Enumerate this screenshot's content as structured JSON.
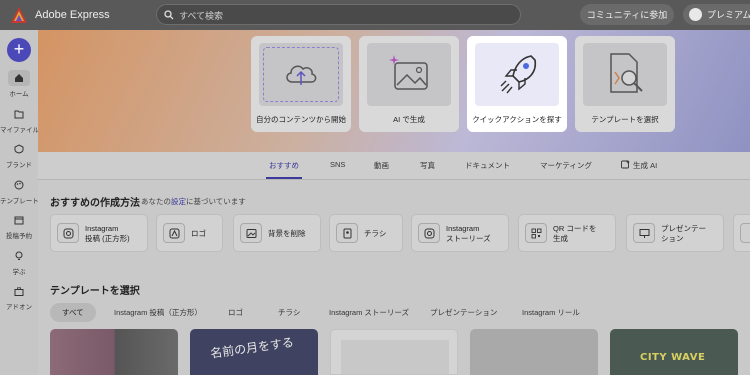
{
  "app": {
    "title": "Adobe Express"
  },
  "search": {
    "placeholder": "すべて検索"
  },
  "header": {
    "community_label": "コミュニティに参加",
    "premium_label": "プレミアム"
  },
  "sidebar": {
    "items": [
      {
        "label": "ホーム",
        "icon": "home-icon"
      },
      {
        "label": "マイファイル",
        "icon": "folder-icon"
      },
      {
        "label": "ブランド",
        "icon": "brand-icon"
      },
      {
        "label": "テンプレート",
        "icon": "palette-icon"
      },
      {
        "label": "投稿予約",
        "icon": "calendar-icon"
      },
      {
        "label": "学ぶ",
        "icon": "lightbulb-icon"
      },
      {
        "label": "アドオン",
        "icon": "briefcase-icon"
      }
    ]
  },
  "hero": {
    "cards": [
      {
        "label": "自分のコンテンツから開始",
        "icon": "cloud-upload-icon"
      },
      {
        "label": "AI で生成",
        "icon": "ai-image-icon"
      },
      {
        "label": "クイックアクションを探す",
        "icon": "rocket-icon"
      },
      {
        "label": "テンプレートを選択",
        "icon": "template-search-icon"
      }
    ]
  },
  "tabs": [
    "おすすめ",
    "SNS",
    "動画",
    "写真",
    "ドキュメント",
    "マーケティング",
    "生成 AI"
  ],
  "recommend": {
    "title": "おすすめの作成方法",
    "sub_prefix": "あなたの",
    "sub_link": "設定",
    "sub_suffix": "に基づいています",
    "items": [
      {
        "line1": "Instagram",
        "line2": "投稿 (正方形)"
      },
      {
        "line1": "ロゴ",
        "line2": ""
      },
      {
        "line1": "背景を削除",
        "line2": ""
      },
      {
        "line1": "チラシ",
        "line2": ""
      },
      {
        "line1": "Instagram",
        "line2": "ストーリーズ"
      },
      {
        "line1": "QR コードを",
        "line2": "生成"
      },
      {
        "line1": "プレゼンテー",
        "line2": "ション"
      }
    ]
  },
  "templates": {
    "title": "テンプレートを選択",
    "filters": [
      "すべて",
      "Instagram 投稿（正方形）",
      "ロゴ",
      "チラシ",
      "Instagram ストーリーズ",
      "プレゼンテーション",
      "Instagram リール"
    ],
    "thumb2_text": "名前の月をする",
    "thumb5_text": "CITY WAVE"
  },
  "colors": {
    "accent": "#3b3a9c",
    "fab": "#4b48b8"
  }
}
